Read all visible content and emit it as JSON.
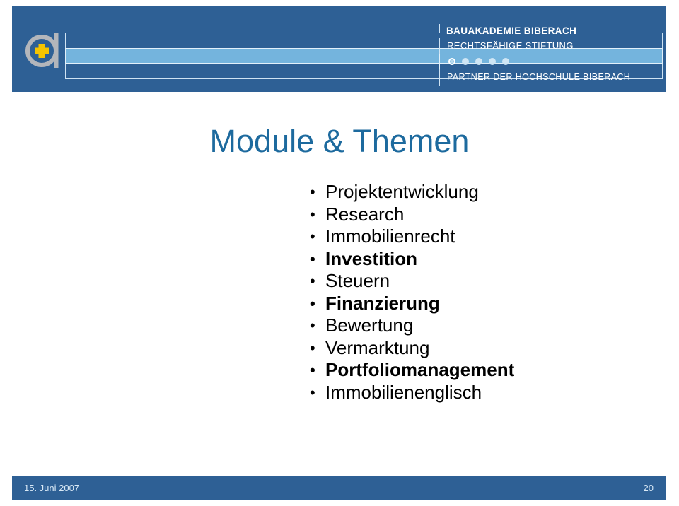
{
  "slide": {
    "colors": {
      "header_blue": "#2e6095",
      "accent_light_blue": "#74b4dd",
      "title_blue": "#1d6a9e",
      "logo_gray": "#b0b3b8",
      "logo_plus_yellow": "#f5c400",
      "footer_text": "#d9e9f6"
    }
  },
  "header": {
    "logo": {
      "letter": "a",
      "mark": "plus"
    },
    "organization": "BAUAKADEMIE  BIBERACH",
    "legal_form": "RECHTSFÄHIGE  STIFTUNG",
    "partner_line": "PARTNER DER HOCHSCHULE BIBERACH",
    "dots": [
      {
        "style": "ringed"
      },
      {
        "style": "plain"
      },
      {
        "style": "plain"
      },
      {
        "style": "plain"
      },
      {
        "style": "plain"
      }
    ]
  },
  "main": {
    "title": "Module & Themen",
    "bullets": [
      {
        "label": "Projektentwicklung",
        "bold": false
      },
      {
        "label": "Research",
        "bold": false
      },
      {
        "label": "Immobilienrecht",
        "bold": false
      },
      {
        "label": "Investition",
        "bold": true
      },
      {
        "label": "Steuern",
        "bold": false
      },
      {
        "label": "Finanzierung",
        "bold": true
      },
      {
        "label": "Bewertung",
        "bold": false
      },
      {
        "label": "Vermarktung",
        "bold": false
      },
      {
        "label": "Portfoliomanagement",
        "bold": true
      },
      {
        "label": "Immobilienenglisch",
        "bold": false
      }
    ]
  },
  "footer": {
    "date": "15. Juni 2007",
    "page_number": "20"
  }
}
